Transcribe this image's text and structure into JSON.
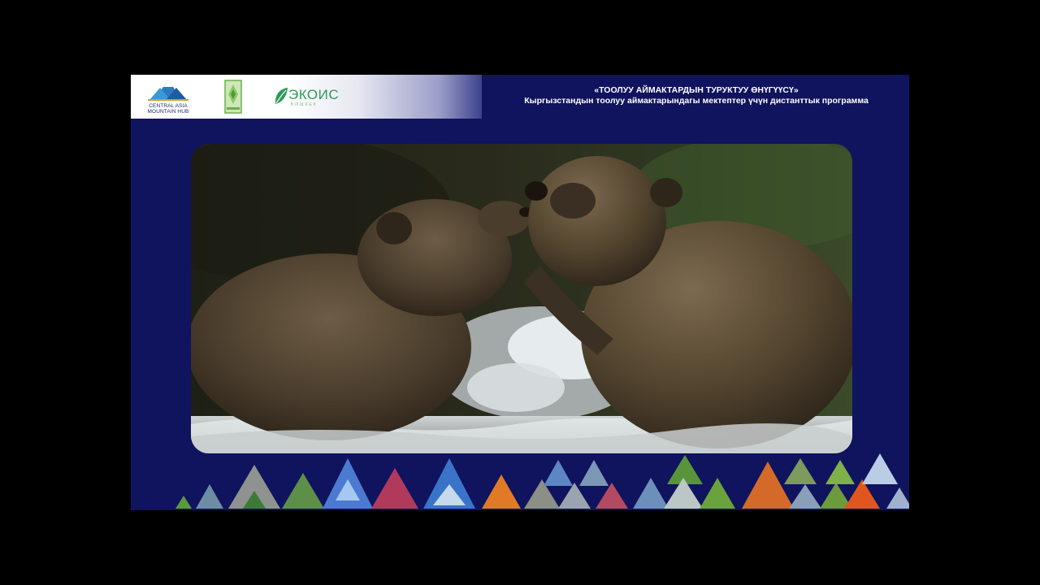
{
  "header": {
    "line1": "«ТООЛУУ АЙМАКТАРДЫН ТУРУКТУУ ӨНҮГҮҮСҮ»",
    "line2": "Кыргызстандын тоолуу аймактарындагы мектептер үчүн дистанттык программа"
  },
  "logos": {
    "camp": {
      "line1": "CENTRAL ASIA",
      "line2": "MOUNTAIN HUB"
    },
    "ekois": {
      "name": "ЭКОИС",
      "sub": "БИШКЕК"
    }
  },
  "colors": {
    "slide_bg": "#10135e",
    "header_text": "#ffffff",
    "ekois_green": "#2e9a57"
  }
}
